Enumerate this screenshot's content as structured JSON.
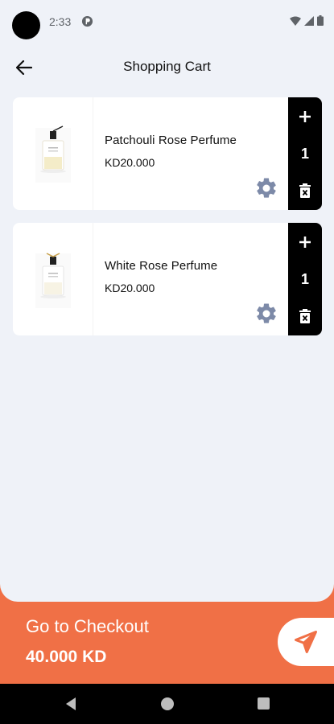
{
  "status_bar": {
    "time": "2:33"
  },
  "app_bar": {
    "title": "Shopping Cart"
  },
  "cart": {
    "items": [
      {
        "name": "Patchouli Rose Perfume",
        "price": "KD20.000",
        "quantity": "1"
      },
      {
        "name": "White Rose Perfume",
        "price": "KD20.000",
        "quantity": "1"
      }
    ]
  },
  "checkout": {
    "label": "Go to Checkout",
    "total": "40.000 KD"
  },
  "colors": {
    "accent": "#f07046",
    "background": "#eff2f8",
    "card": "#ffffff",
    "qty_panel": "#000000",
    "settings_icon": "#7d8aa8"
  }
}
